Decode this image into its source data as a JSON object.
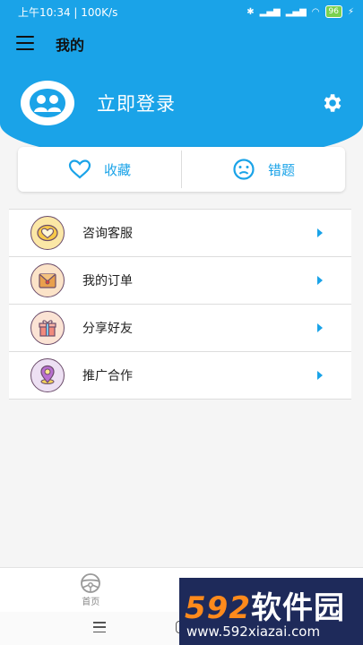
{
  "status_bar": {
    "left": "上午10:34 | 100K/s",
    "battery": "96"
  },
  "header": {
    "title": "我的",
    "login": "立即登录"
  },
  "quick": [
    {
      "label": "收藏",
      "icon": "heart-icon"
    },
    {
      "label": "错题",
      "icon": "sad-face-icon"
    }
  ],
  "menu": [
    {
      "label": "咨询客服",
      "icon": "heart-badge-icon"
    },
    {
      "label": "我的订单",
      "icon": "envelope-icon"
    },
    {
      "label": "分享好友",
      "icon": "gift-icon"
    },
    {
      "label": "推广合作",
      "icon": "location-pin-icon"
    }
  ],
  "tabs": [
    {
      "label": "首页",
      "icon": "steering-wheel-icon"
    },
    {
      "label": "",
      "icon": "person-icon"
    }
  ],
  "watermark": {
    "brand_num": "592",
    "brand_text": "软件园",
    "url": "www.592xiazai.com"
  },
  "colors": {
    "primary": "#1aa3e8"
  }
}
